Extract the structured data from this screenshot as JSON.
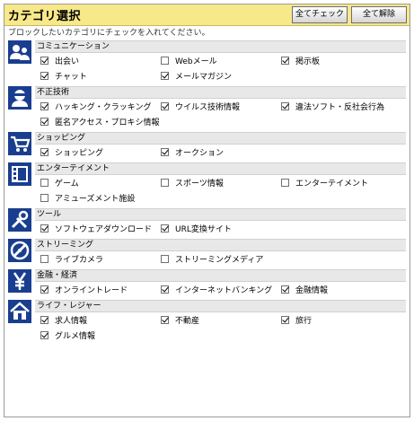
{
  "header": {
    "title": "カテゴリ選択",
    "check_all_label": "全てチェック",
    "clear_all_label": "全て解除"
  },
  "instruction": "ブロックしたいカテゴリにチェックを入れてください。",
  "categories": [
    {
      "name": "コミュニケーション",
      "icon": "people-icon",
      "options": [
        {
          "label": "出会い",
          "checked": true
        },
        {
          "label": "Webメール",
          "checked": false
        },
        {
          "label": "掲示板",
          "checked": true
        },
        {
          "label": "チャット",
          "checked": true
        },
        {
          "label": "メールマガジン",
          "checked": true
        }
      ]
    },
    {
      "name": "不正技術",
      "icon": "masked-person-icon",
      "options": [
        {
          "label": "ハッキング・クラッキング",
          "checked": true
        },
        {
          "label": "ウイルス技術情報",
          "checked": true
        },
        {
          "label": "違法ソフト・反社会行為",
          "checked": true
        },
        {
          "label": "匿名アクセス・プロキシ情報",
          "checked": true
        }
      ]
    },
    {
      "name": "ショッピング",
      "icon": "shopping-cart-icon",
      "options": [
        {
          "label": "ショッピング",
          "checked": true
        },
        {
          "label": "オークション",
          "checked": true
        }
      ]
    },
    {
      "name": "エンターテイメント",
      "icon": "film-icon",
      "options": [
        {
          "label": "ゲーム",
          "checked": false
        },
        {
          "label": "スポーツ情報",
          "checked": false
        },
        {
          "label": "エンターテイメント",
          "checked": false
        },
        {
          "label": "アミューズメント施設",
          "checked": false
        }
      ]
    },
    {
      "name": "ツール",
      "icon": "tools-icon",
      "options": [
        {
          "label": "ソフトウェアダウンロード",
          "checked": true
        },
        {
          "label": "URL変換サイト",
          "checked": true
        }
      ]
    },
    {
      "name": "ストリーミング",
      "icon": "disc-icon",
      "options": [
        {
          "label": "ライブカメラ",
          "checked": false
        },
        {
          "label": "ストリーミングメディア",
          "checked": false
        }
      ]
    },
    {
      "name": "金融・経済",
      "icon": "yen-icon",
      "options": [
        {
          "label": "オンライントレード",
          "checked": true
        },
        {
          "label": "インターネットバンキング",
          "checked": true
        },
        {
          "label": "金融情報",
          "checked": true
        }
      ]
    },
    {
      "name": "ライフ・レジャー",
      "icon": "house-icon",
      "options": [
        {
          "label": "求人情報",
          "checked": true
        },
        {
          "label": "不動産",
          "checked": true
        },
        {
          "label": "旅行",
          "checked": true
        },
        {
          "label": "グルメ情報",
          "checked": true
        }
      ]
    }
  ]
}
